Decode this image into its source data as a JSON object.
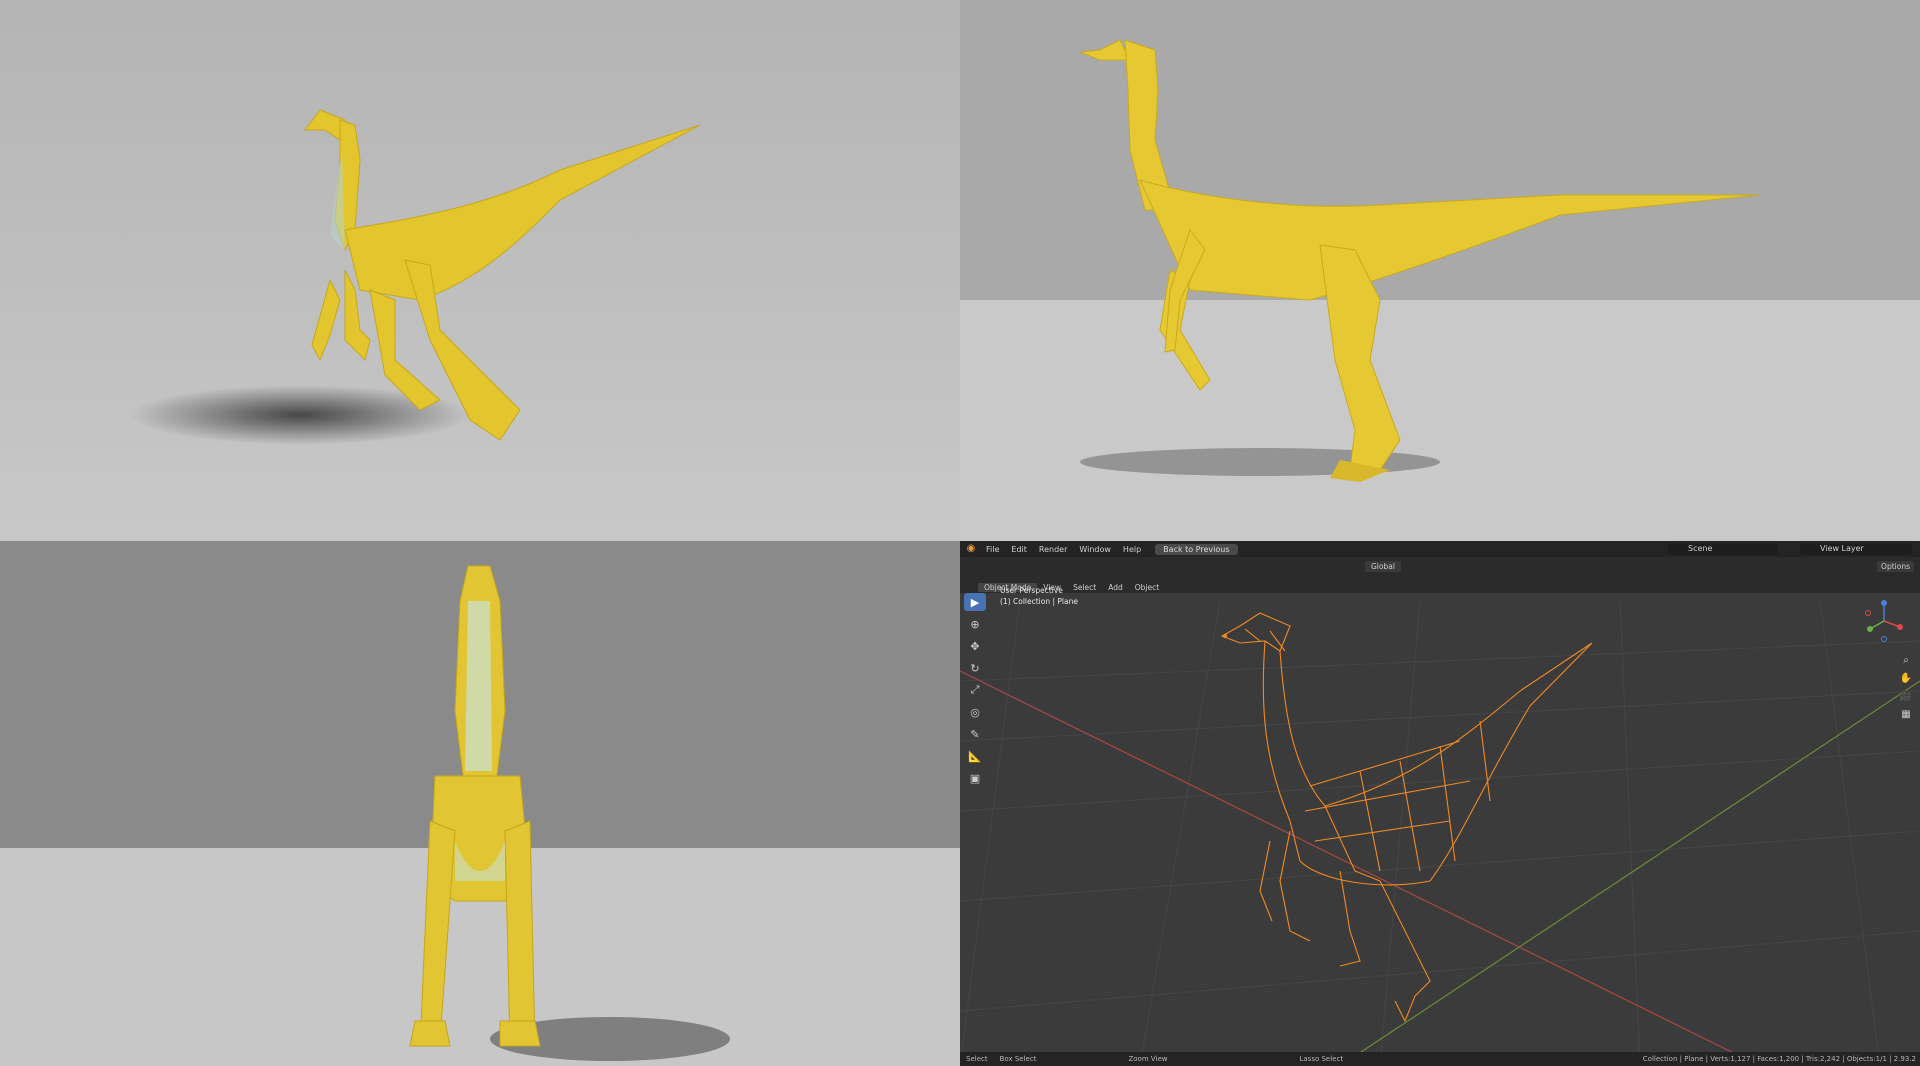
{
  "blender": {
    "menu": [
      "File",
      "Edit",
      "Render",
      "Window",
      "Help"
    ],
    "back_button": "Back to Previous",
    "scene_label": "Scene",
    "view_layer_label": "View Layer",
    "mode": "Object Mode",
    "header_menu": [
      "View",
      "Select",
      "Add",
      "Object"
    ],
    "transform_orientation": "Global",
    "options_label": "Options",
    "viewport_title": "User Perspective",
    "viewport_collection": "(1) Collection | Plane",
    "status": {
      "select": "Select",
      "box_select": "Box Select",
      "zoom_view": "Zoom View",
      "lasso_select": "Lasso Select",
      "stats": "Collection | Plane | Verts:1,127 | Faces:1,200 | Tris:2,242 | Objects:1/1 | 2.93.2"
    },
    "colors": {
      "wireframe": "#f08a24",
      "x_axis": "#a84848",
      "y_axis": "#6a8c3a",
      "active_tool": "#4772b3"
    },
    "tools": [
      "select-box-icon",
      "cursor-icon",
      "move-icon",
      "rotate-icon",
      "scale-icon",
      "transform-icon",
      "annotate-icon",
      "measure-icon",
      "add-cube-icon"
    ]
  },
  "renders": {
    "dinosaur_color": "#e6c832",
    "background_light": "#c4c4c4",
    "background_dark": "#8e8e8e"
  }
}
